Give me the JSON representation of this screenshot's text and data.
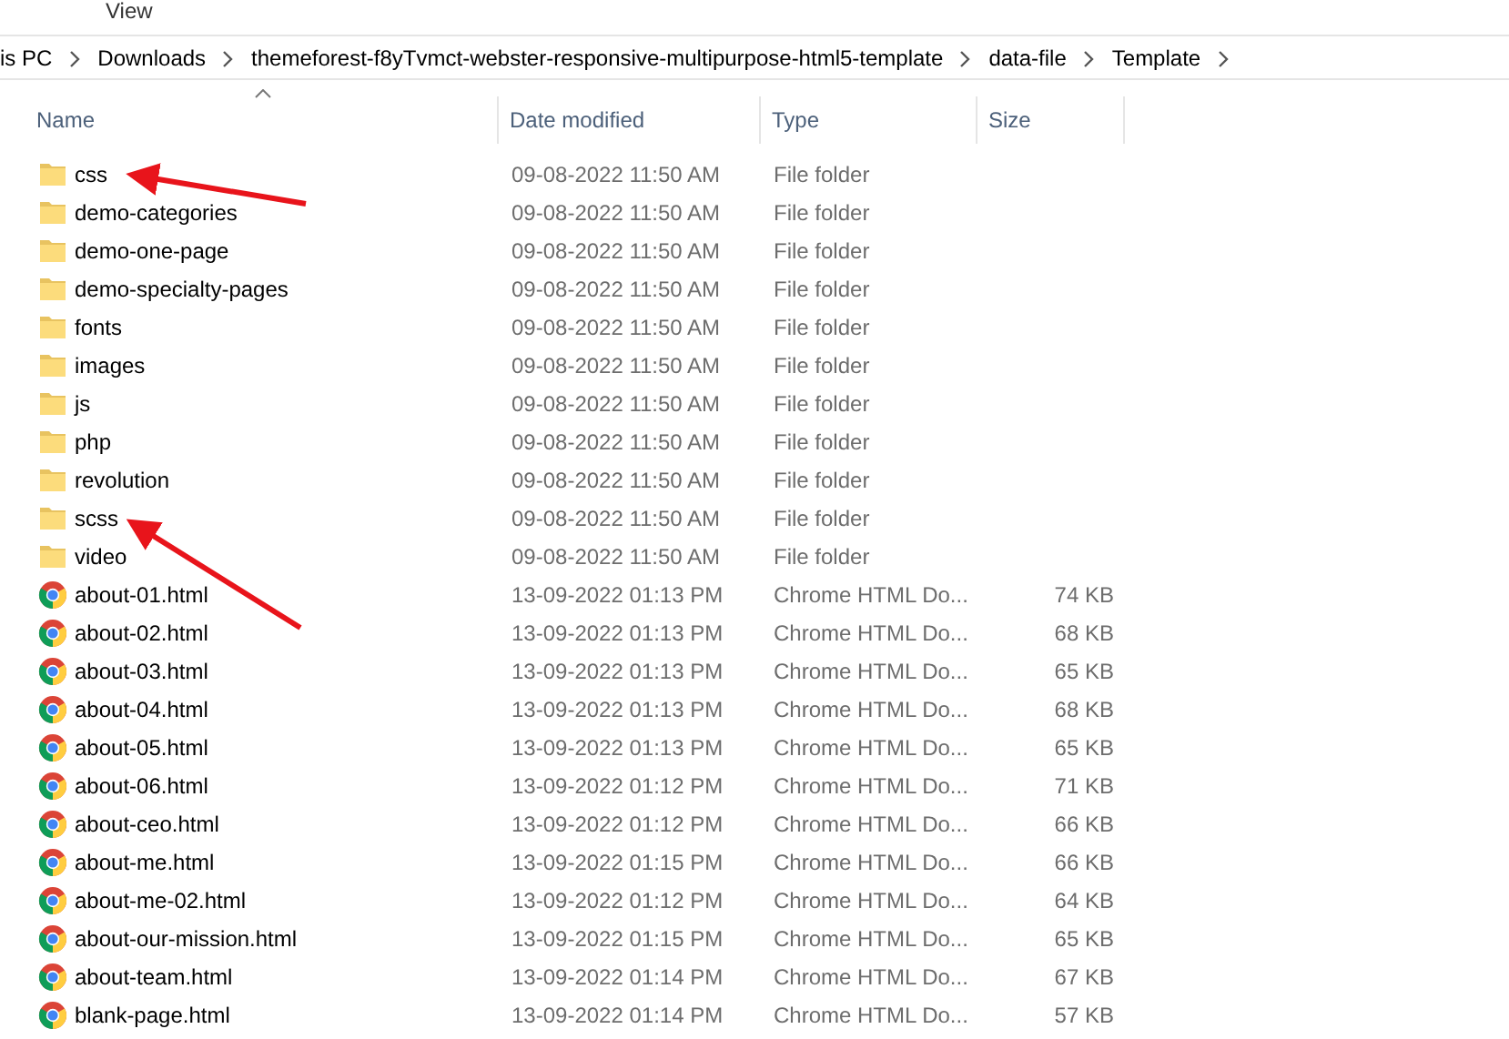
{
  "ribbon": {
    "tabs": [
      {
        "label": "View",
        "selected": false
      }
    ]
  },
  "breadcrumb": [
    "is PC",
    "Downloads",
    "themeforest-f8yTvmct-webster-responsive-multipurpose-html5-template",
    "data-file",
    "Template"
  ],
  "columns": [
    {
      "label": "Name",
      "sorted": true
    },
    {
      "label": "Date modified",
      "sorted": false
    },
    {
      "label": "Type",
      "sorted": false
    },
    {
      "label": "Size",
      "sorted": false
    }
  ],
  "files": [
    {
      "kind": "folder",
      "name": "css",
      "date": "09-08-2022 11:50 AM",
      "type": "File folder"
    },
    {
      "kind": "folder",
      "name": "demo-categories",
      "date": "09-08-2022 11:50 AM",
      "type": "File folder"
    },
    {
      "kind": "folder",
      "name": "demo-one-page",
      "date": "09-08-2022 11:50 AM",
      "type": "File folder"
    },
    {
      "kind": "folder",
      "name": "demo-specialty-pages",
      "date": "09-08-2022 11:50 AM",
      "type": "File folder"
    },
    {
      "kind": "folder",
      "name": "fonts",
      "date": "09-08-2022 11:50 AM",
      "type": "File folder"
    },
    {
      "kind": "folder",
      "name": "images",
      "date": "09-08-2022 11:50 AM",
      "type": "File folder"
    },
    {
      "kind": "folder",
      "name": "js",
      "date": "09-08-2022 11:50 AM",
      "type": "File folder"
    },
    {
      "kind": "folder",
      "name": "php",
      "date": "09-08-2022 11:50 AM",
      "type": "File folder"
    },
    {
      "kind": "folder",
      "name": "revolution",
      "date": "09-08-2022 11:50 AM",
      "type": "File folder"
    },
    {
      "kind": "folder",
      "name": "scss",
      "date": "09-08-2022 11:50 AM",
      "type": "File folder"
    },
    {
      "kind": "folder",
      "name": "video",
      "date": "09-08-2022 11:50 AM",
      "type": "File folder"
    },
    {
      "kind": "html",
      "name": "about-01.html",
      "date": "13-09-2022 01:13 PM",
      "type": "Chrome HTML Do...",
      "size": "74 KB"
    },
    {
      "kind": "html",
      "name": "about-02.html",
      "date": "13-09-2022 01:13 PM",
      "type": "Chrome HTML Do...",
      "size": "68 KB"
    },
    {
      "kind": "html",
      "name": "about-03.html",
      "date": "13-09-2022 01:13 PM",
      "type": "Chrome HTML Do...",
      "size": "65 KB"
    },
    {
      "kind": "html",
      "name": "about-04.html",
      "date": "13-09-2022 01:13 PM",
      "type": "Chrome HTML Do...",
      "size": "68 KB"
    },
    {
      "kind": "html",
      "name": "about-05.html",
      "date": "13-09-2022 01:13 PM",
      "type": "Chrome HTML Do...",
      "size": "65 KB"
    },
    {
      "kind": "html",
      "name": "about-06.html",
      "date": "13-09-2022 01:12 PM",
      "type": "Chrome HTML Do...",
      "size": "71 KB"
    },
    {
      "kind": "html",
      "name": "about-ceo.html",
      "date": "13-09-2022 01:12 PM",
      "type": "Chrome HTML Do...",
      "size": "66 KB"
    },
    {
      "kind": "html",
      "name": "about-me.html",
      "date": "13-09-2022 01:15 PM",
      "type": "Chrome HTML Do...",
      "size": "66 KB"
    },
    {
      "kind": "html",
      "name": "about-me-02.html",
      "date": "13-09-2022 01:12 PM",
      "type": "Chrome HTML Do...",
      "size": "64 KB"
    },
    {
      "kind": "html",
      "name": "about-our-mission.html",
      "date": "13-09-2022 01:15 PM",
      "type": "Chrome HTML Do...",
      "size": "65 KB"
    },
    {
      "kind": "html",
      "name": "about-team.html",
      "date": "13-09-2022 01:14 PM",
      "type": "Chrome HTML Do...",
      "size": "67 KB"
    },
    {
      "kind": "html",
      "name": "blank-page.html",
      "date": "13-09-2022 01:14 PM",
      "type": "Chrome HTML Do...",
      "size": "57 KB"
    }
  ]
}
